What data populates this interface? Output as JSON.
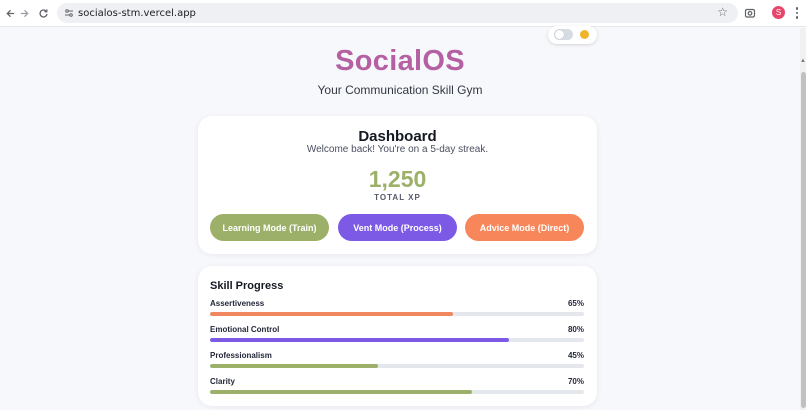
{
  "browser": {
    "url": "socialos-stm.vercel.app",
    "profile_initial": "S"
  },
  "header": {
    "title": "SocialOS",
    "subtitle": "Your Communication Skill Gym"
  },
  "dashboard": {
    "title": "Dashboard",
    "welcome": "Welcome back! You're on a 5-day streak.",
    "xp_value": "1,250",
    "xp_label": "TOTAL XP",
    "modes": [
      {
        "label": "Learning Mode (Train)",
        "color": "#9cb06a"
      },
      {
        "label": "Vent Mode (Process)",
        "color": "#7c5ae6"
      },
      {
        "label": "Advice Mode (Direct)",
        "color": "#f7875a"
      }
    ]
  },
  "skills": {
    "title": "Skill Progress",
    "items": [
      {
        "name": "Assertiveness",
        "percent_label": "65%",
        "value": 65,
        "color": "#f0875f"
      },
      {
        "name": "Emotional Control",
        "percent_label": "80%",
        "value": 80,
        "color": "#7c5ae6"
      },
      {
        "name": "Professionalism",
        "percent_label": "45%",
        "value": 45,
        "color": "#9cb06a"
      },
      {
        "name": "Clarity",
        "percent_label": "70%",
        "value": 70,
        "color": "#9cb06a"
      }
    ]
  },
  "colors": {
    "brand": "#b460a3",
    "xp": "#9cb06a"
  }
}
